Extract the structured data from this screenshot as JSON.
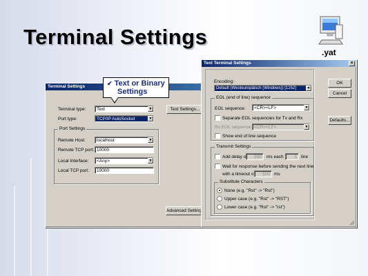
{
  "slide": {
    "title": "Terminal Settings",
    "yat_label": ".yat",
    "callout": {
      "check": "✔",
      "line1": "Text or Binary",
      "line2": "Settings"
    }
  },
  "terminal_window": {
    "title": "Terminal Settings",
    "terminal_type_label": "Terminal type:",
    "terminal_type_value": "Text",
    "text_settings_button": "Text Settings...",
    "port_type_label": "Port type:",
    "port_type_value": "TCP/IP AutoSocket",
    "port_settings_group": "Port Settings",
    "remote_host_label": "Remote Host:",
    "remote_host_value": "localhost",
    "remote_tcp_port_label": "Remote TCP port:",
    "remote_tcp_port_value": "10000",
    "local_interface_label": "Local Interface:",
    "local_interface_value": "<Any>",
    "local_tcp_port_label": "Local TCP port:",
    "local_tcp_port_value": "10000",
    "advanced_button": "Advanced Settings"
  },
  "text_window": {
    "title": "Text Terminal Settings",
    "close_glyph": "×",
    "encoding_label": "Encoding:",
    "encoding_value": "Default (Westeuropäisch (Windows)) [1252]",
    "ok_button": "OK",
    "cancel_button": "Cancel",
    "defaults_button": "Defaults...",
    "eol_group": "EOL (end of line) sequence",
    "eol_sequence_label": "EOL sequence:",
    "eol_sequence_value": "<CR><LF>",
    "separate_eol_label": "Separate EOL sequencies for Tx and Rx",
    "rx_eol_label": "Rx EOL sequence:",
    "rx_eol_value": "<CR><LF>",
    "show_eol_label": "Show end of line sequence",
    "transmit_group": "Transmit Settings",
    "add_delay_label": "Add delay of",
    "delay_value": "500",
    "ms_each": "ms each",
    "each_value": "1",
    "line_label": "line",
    "wait_label": "Wait for response before sending the next line",
    "timeout_label": "with a timeout of",
    "timeout_value": "500",
    "ms_label": "ms",
    "subst_group": "Substitute Characters",
    "none_label": "None (e.g. \"Rst\" -> \"Rst\")",
    "upper_label": "Upper case (e.g. \"Rst\" -> \"RST\")",
    "lower_label": "Lower case (e.g. \"Rst\" -> \"rst\")"
  }
}
